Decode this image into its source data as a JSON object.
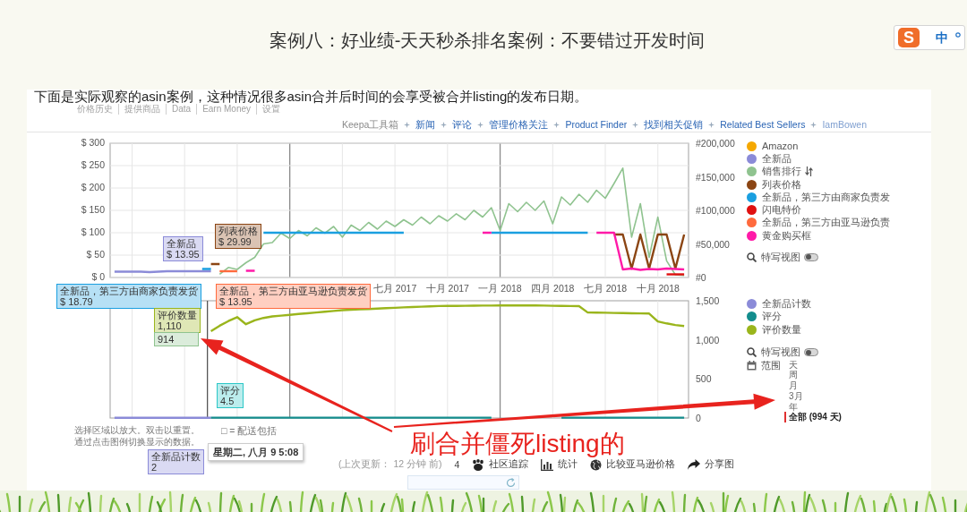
{
  "page": {
    "title": "案例八：好业绩-天天秒杀排名案例：不要错过开发时间"
  },
  "ime_toolbar": {
    "logo": "S",
    "mode": "中"
  },
  "document": {
    "intro": "下面是实际观察的asin案例，这种情况很多asin合并后时间的会享受被合并listing的发布日期。",
    "tabs": [
      "价格历史",
      "提供商品",
      "Data",
      "Earn Money",
      "设置"
    ],
    "toolbar_links": [
      {
        "label": "Keepa工具箱",
        "kind": "label"
      },
      {
        "label": "新闻",
        "kind": "link"
      },
      {
        "label": "评论",
        "kind": "link"
      },
      {
        "label": "管理价格关注",
        "kind": "link"
      },
      {
        "label": "Product Finder",
        "kind": "link"
      },
      {
        "label": "找到相关促销",
        "kind": "link"
      },
      {
        "label": "Related Best Sellers",
        "kind": "link"
      },
      {
        "label": "IamBowen",
        "kind": "user"
      }
    ],
    "upper_chart": {
      "chart_data": {
        "type": "line",
        "grid": true,
        "categories": [
          null,
          null,
          null,
          null,
          null,
          null,
          null,
          null,
          null,
          null,
          null,
          null,
          null,
          null,
          null,
          null,
          null,
          null,
          null,
          null,
          null,
          null,
          null,
          null,
          null,
          null,
          null,
          null,
          null,
          null,
          null,
          null,
          "七月 2017",
          null,
          null,
          null,
          null,
          null,
          "十月 2017",
          null,
          null,
          null,
          null,
          null,
          "一月 2018",
          null,
          null,
          null,
          null,
          null,
          "四月 2018",
          null,
          null,
          null,
          null,
          null,
          "七月 2018",
          null,
          null,
          null,
          null,
          null,
          "十月 2018",
          null,
          null,
          null
        ],
        "ylim": [
          0,
          300
        ],
        "yticks": [
          {
            "value": 0,
            "label": "$ 0"
          },
          {
            "value": 50,
            "label": "$ 50"
          },
          {
            "value": 100,
            "label": "$ 100"
          },
          {
            "value": 150,
            "label": "$ 150"
          },
          {
            "value": 200,
            "label": "$ 200"
          },
          {
            "value": 250,
            "label": "$ 250"
          },
          {
            "value": 300,
            "label": "$ 300"
          }
        ],
        "y2lim": [
          0,
          200000
        ],
        "y2ticks": [
          {
            "value": 0,
            "label": "#0"
          },
          {
            "value": 50000,
            "label": "#50,000"
          },
          {
            "value": 100000,
            "label": "#100,000"
          },
          {
            "value": 150000,
            "label": "#150,000"
          },
          {
            "value": 200000,
            "label": "#200,000"
          }
        ],
        "series": [
          {
            "name": "Amazon",
            "color": "#f5a800",
            "values": [
              null,
              null,
              null,
              null,
              null,
              null,
              null,
              null,
              null,
              null,
              null,
              null,
              null,
              null,
              null,
              null,
              null,
              null,
              null,
              null,
              null,
              null,
              null,
              null,
              null,
              null,
              null,
              null,
              null,
              null,
              null,
              null,
              null,
              null,
              null,
              null,
              null,
              null,
              null,
              null,
              null,
              null,
              null,
              null,
              null,
              null,
              null,
              null,
              null,
              null,
              null,
              null,
              null,
              null,
              null,
              null,
              null,
              null,
              null,
              null,
              null,
              null,
              null,
              null,
              null,
              null
            ]
          },
          {
            "name": "全新品",
            "color": "#8b8bd8",
            "values": [
              13,
              13,
              13,
              13,
              12,
              13,
              14,
              14,
              14,
              14,
              14,
              14,
              null,
              null,
              null,
              null,
              null,
              null,
              null,
              null,
              null,
              null,
              null,
              null,
              null,
              null,
              null,
              null,
              null,
              null,
              null,
              null,
              null,
              null,
              null,
              null,
              null,
              null,
              null,
              null,
              null,
              null,
              null,
              null,
              null,
              null,
              null,
              null,
              null,
              null,
              null,
              null,
              null,
              null,
              null,
              null,
              null,
              null,
              null,
              null,
              null,
              null,
              null,
              null,
              null,
              null
            ]
          },
          {
            "name": "销售排行",
            "color": "#8fc38f",
            "axis": "y2",
            "values": [
              null,
              null,
              null,
              null,
              null,
              null,
              null,
              null,
              null,
              null,
              null,
              null,
              5000,
              15000,
              12000,
              22000,
              30000,
              50000,
              52000,
              66000,
              58000,
              70000,
              62000,
              74000,
              66000,
              76000,
              60000,
              78000,
              70000,
              82000,
              72000,
              84000,
              76000,
              86000,
              78000,
              90000,
              80000,
              92000,
              84000,
              95000,
              86000,
              100000,
              90000,
              104000,
              70000,
              110000,
              98000,
              112000,
              100000,
              114000,
              80000,
              120000,
              108000,
              124000,
              112000,
              130000,
              118000,
              140000,
              163000,
              60000,
              110000,
              30000,
              90000,
              25000,
              4000,
              3000
            ]
          },
          {
            "name": "列表价格",
            "color": "#8b4513",
            "values": [
              null,
              null,
              null,
              null,
              null,
              null,
              null,
              null,
              null,
              null,
              null,
              30,
              30,
              null,
              null,
              null,
              null,
              null,
              null,
              null,
              null,
              null,
              null,
              null,
              null,
              null,
              null,
              null,
              null,
              null,
              null,
              null,
              null,
              null,
              null,
              null,
              null,
              null,
              null,
              null,
              null,
              null,
              null,
              null,
              null,
              null,
              null,
              null,
              null,
              null,
              null,
              null,
              null,
              null,
              null,
              null,
              null,
              96,
              96,
              20,
              96,
              20,
              96,
              96,
              20,
              96
            ]
          },
          {
            "name": "全新品，第三方由商家负责发",
            "color": "#1a9fe0",
            "values": [
              null,
              null,
              null,
              null,
              null,
              null,
              null,
              null,
              null,
              null,
              19,
              19,
              null,
              null,
              null,
              null,
              null,
              100,
              100,
              100,
              100,
              100,
              100,
              100,
              100,
              100,
              100,
              100,
              100,
              100,
              100,
              100,
              100,
              100,
              null,
              null,
              null,
              null,
              null,
              null,
              null,
              null,
              null,
              100,
              100,
              100,
              100,
              100,
              100,
              100,
              100,
              100,
              100,
              100,
              100,
              null,
              null,
              null,
              null,
              null,
              null,
              null,
              null,
              null,
              null,
              null
            ]
          },
          {
            "name": "闪电特价",
            "color": "#e01010",
            "values": [
              null,
              null,
              null,
              null,
              null,
              null,
              null,
              null,
              null,
              null,
              null,
              null,
              null,
              null,
              null,
              null,
              null,
              null,
              null,
              null,
              null,
              null,
              null,
              null,
              null,
              null,
              null,
              null,
              null,
              null,
              null,
              null,
              null,
              null,
              null,
              null,
              null,
              null,
              null,
              null,
              null,
              null,
              null,
              null,
              null,
              null,
              null,
              null,
              null,
              null,
              null,
              null,
              null,
              null,
              null,
              null,
              null,
              null,
              null,
              null,
              null,
              null,
              null,
              7,
              7,
              7
            ]
          },
          {
            "name": "全新品，第三方由亚马逊负责",
            "color": "#ff6a3d",
            "values": [
              null,
              null,
              null,
              null,
              null,
              null,
              null,
              null,
              null,
              null,
              null,
              null,
              14,
              14,
              14,
              null,
              null,
              null,
              null,
              null,
              null,
              null,
              null,
              null,
              null,
              null,
              null,
              null,
              null,
              null,
              null,
              null,
              null,
              null,
              null,
              null,
              null,
              null,
              null,
              null,
              null,
              null,
              null,
              null,
              null,
              null,
              null,
              null,
              null,
              null,
              null,
              null,
              null,
              null,
              null,
              null,
              null,
              null,
              null,
              null,
              null,
              null,
              null,
              null,
              null,
              null
            ]
          },
          {
            "name": "黄金购买框",
            "color": "#ff1aa8",
            "values": [
              null,
              null,
              null,
              null,
              null,
              null,
              null,
              null,
              null,
              null,
              null,
              null,
              null,
              null,
              null,
              15,
              15,
              null,
              null,
              null,
              null,
              null,
              null,
              null,
              null,
              null,
              null,
              null,
              null,
              null,
              null,
              null,
              null,
              null,
              null,
              null,
              null,
              null,
              null,
              null,
              null,
              null,
              100,
              100,
              null,
              null,
              null,
              null,
              null,
              null,
              null,
              null,
              null,
              null,
              null,
              100,
              100,
              100,
              18,
              20,
              17,
              19,
              18,
              20,
              19,
              18
            ]
          }
        ]
      },
      "legend": [
        {
          "kind": "series"
        },
        {
          "kind": "series"
        },
        {
          "kind": "sortable"
        },
        {
          "kind": "series"
        },
        {
          "kind": "series"
        },
        {
          "kind": "series"
        },
        {
          "kind": "series"
        },
        {
          "kind": "series"
        }
      ],
      "close_up": {
        "label": "特写视图",
        "on": false
      }
    },
    "lower_chart": {
      "chart_data": {
        "type": "line",
        "grid": true,
        "categories": [
          null,
          null,
          null,
          null,
          null,
          null,
          null,
          null,
          null,
          null,
          null,
          null,
          null,
          null,
          null,
          null,
          null,
          null,
          null,
          null,
          null,
          null,
          null,
          null,
          null,
          null,
          null,
          null,
          null,
          null,
          null,
          null,
          null,
          null,
          null,
          null,
          null,
          null,
          null,
          null,
          null,
          null,
          null,
          null,
          null,
          null,
          null,
          null,
          null,
          null,
          null,
          null,
          null,
          null,
          null,
          null,
          null,
          null,
          null,
          null,
          null,
          null,
          null,
          null,
          null,
          null
        ],
        "ylim": [
          0,
          1500
        ],
        "yticks": [
          {
            "value": 0,
            "label": "0"
          },
          {
            "value": 500,
            "label": "500"
          },
          {
            "value": 1000,
            "label": "1,000"
          },
          {
            "value": 1500,
            "label": "1,500"
          }
        ],
        "series": [
          {
            "name": "全新品计数",
            "color": "#8b8bd8",
            "values": [
              2,
              2,
              2,
              2,
              2,
              2,
              2,
              2,
              2,
              2,
              2,
              2,
              null,
              null,
              null,
              null,
              null,
              null,
              null,
              null,
              null,
              null,
              null,
              null,
              null,
              null,
              null,
              null,
              null,
              null,
              null,
              null,
              null,
              null,
              null,
              null,
              null,
              null,
              null,
              null,
              null,
              null,
              null,
              null,
              null,
              null,
              null,
              null,
              null,
              null,
              null,
              null,
              null,
              null,
              null,
              null,
              null,
              null,
              null,
              null,
              null,
              null,
              null,
              null,
              null,
              null
            ]
          },
          {
            "name": "评分",
            "color": "#138d8d",
            "values": [
              null,
              null,
              null,
              null,
              null,
              null,
              null,
              null,
              null,
              null,
              null,
              4.5,
              4.5,
              4.5,
              4.5,
              4.5,
              4.5,
              4.5,
              4.5,
              4.5,
              4.5,
              4.5,
              4.5,
              4.5,
              4.5,
              4.5,
              4.5,
              4.5,
              4.5,
              4.5,
              4.5,
              4.5,
              4.5,
              4.5,
              4.5,
              4.5,
              4.5,
              4.5,
              4.5,
              4.5,
              4.5,
              4.5,
              4.5,
              4.5,
              null,
              null,
              null,
              null,
              null,
              null,
              null,
              4.5,
              4.5,
              4.5,
              4.5,
              4.5,
              4.5,
              4.5,
              4.5,
              4.5,
              4.5,
              4.5,
              4.5,
              4.5,
              4.5,
              4.5
            ]
          },
          {
            "name": "评价数量",
            "color": "#9ab51c",
            "values": [
              null,
              null,
              null,
              null,
              null,
              null,
              null,
              null,
              null,
              null,
              null,
              1110,
              1180,
              1240,
              1290,
              1200,
              1250,
              1280,
              1300,
              1310,
              1320,
              1330,
              1340,
              1350,
              1360,
              1370,
              1380,
              1385,
              1390,
              1395,
              1400,
              1405,
              1410,
              1415,
              1420,
              1425,
              1428,
              1432,
              1434,
              1435,
              1436,
              1437,
              1438,
              1438,
              1439,
              1440,
              1440,
              1440,
              1440,
              1438,
              1436,
              1434,
              1432,
              1431,
              1350,
              1348,
              1346,
              1344,
              1342,
              1340,
              1338,
              1336,
              1235,
              1210,
              1190,
              1177
            ]
          }
        ]
      },
      "legend": [
        {
          "kind": "series"
        },
        {
          "kind": "series"
        },
        {
          "kind": "series"
        }
      ],
      "close_up": {
        "label": "特写视图",
        "on": false
      },
      "range": {
        "label": "范围",
        "options": [
          {
            "label": "天",
            "selected": false
          },
          {
            "label": "周",
            "selected": false
          },
          {
            "label": "月",
            "selected": false
          },
          {
            "label": "3月",
            "selected": false
          },
          {
            "label": "年",
            "selected": false
          },
          {
            "label": "全部 (994 天)",
            "selected": true
          }
        ]
      }
    },
    "tooltips": [
      {
        "lines": [
          "全新品",
          "$ 13.95"
        ],
        "color": "#8b8bd8",
        "kind": "series"
      },
      {
        "lines": [
          "列表价格",
          "$ 29.99"
        ],
        "color": "#8b4513",
        "kind": "series"
      },
      {
        "lines": [
          "全新品，第三方由商家负责发货",
          "$ 18.79"
        ],
        "color": "#1a9fe0",
        "kind": "series"
      },
      {
        "lines": [
          "全新品，第三方由亚马逊负责发货",
          "$ 13.95"
        ],
        "color": "#ff6a3d",
        "kind": "series"
      },
      {
        "lines": [
          "评价数量",
          "1,110"
        ],
        "color": "#9ab51c",
        "kind": "series"
      },
      {
        "lines": [
          "914"
        ],
        "color": "#8fc38f",
        "kind": "series"
      },
      {
        "lines": [
          "评分",
          "4.5"
        ],
        "color": "#2cc7c7",
        "kind": "series"
      },
      {
        "lines": [
          "星期二, 八月 9 5:08"
        ],
        "kind": "date"
      },
      {
        "lines": [
          "全新品计数",
          "2"
        ],
        "color": "#8b8bd8",
        "kind": "series"
      }
    ],
    "hint": [
      "选择区域以放大。双击以重置。",
      "通过点击图例切换显示的数据。"
    ],
    "shipping_note": "□ = 配送包括",
    "footer": {
      "updated": "(上次更新： 12 分钟 前)",
      "count": "4",
      "links": [
        {
          "label": "社区追踪",
          "kind": "community"
        },
        {
          "label": "统计",
          "kind": "stats"
        },
        {
          "label": "比较亚马逊价格",
          "kind": "compare"
        },
        {
          "label": "分享图",
          "kind": "share"
        }
      ]
    }
  },
  "annotation": {
    "text": "刷合并僵死listing的"
  }
}
